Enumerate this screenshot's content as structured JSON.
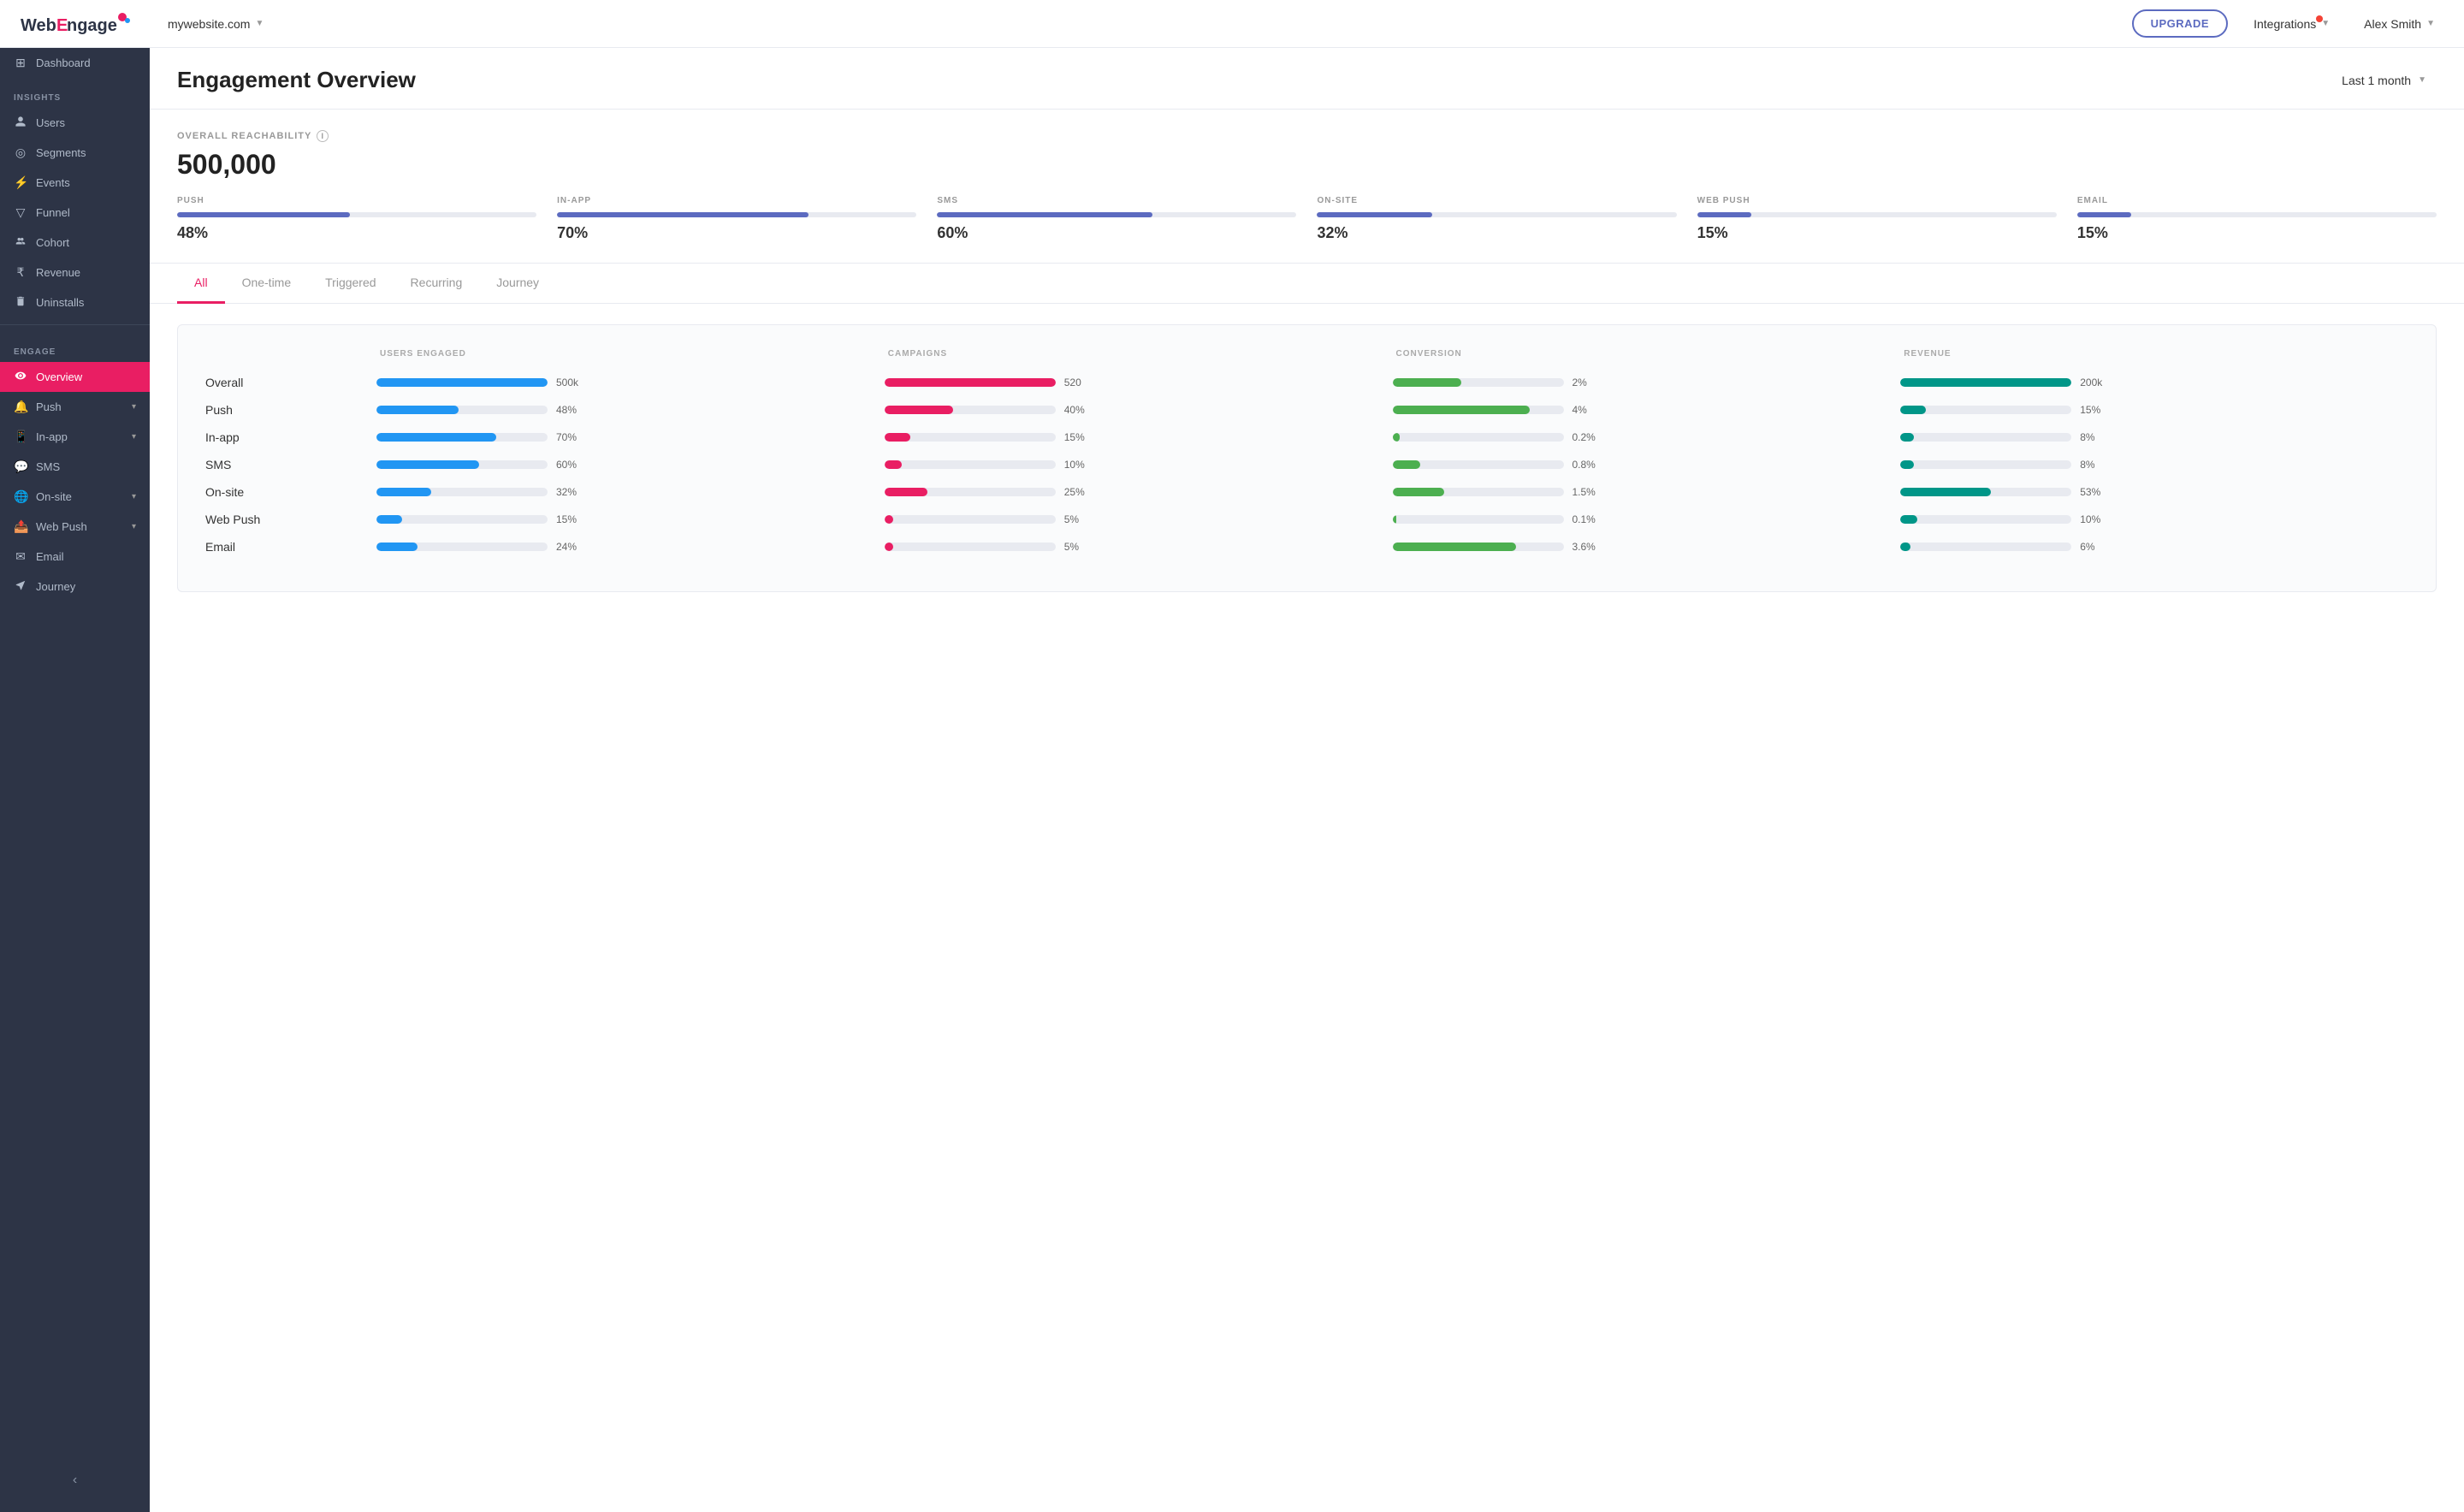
{
  "topnav": {
    "logo_text": "WebEngage",
    "site": "mywebsite.com",
    "upgrade_label": "UPGRADE",
    "integrations_label": "Integrations",
    "user_name": "Alex Smith"
  },
  "sidebar": {
    "insights_label": "INSIGHTS",
    "engage_label": "ENGAGE",
    "items": [
      {
        "id": "dashboard",
        "label": "Dashboard",
        "icon": "⊞"
      },
      {
        "id": "users",
        "label": "Users",
        "icon": "👤"
      },
      {
        "id": "segments",
        "label": "Segments",
        "icon": "◎"
      },
      {
        "id": "events",
        "label": "Events",
        "icon": "⚡"
      },
      {
        "id": "funnel",
        "label": "Funnel",
        "icon": "▽"
      },
      {
        "id": "cohort",
        "label": "Cohort",
        "icon": "👥"
      },
      {
        "id": "revenue",
        "label": "Revenue",
        "icon": "₹"
      },
      {
        "id": "uninstalls",
        "label": "Uninstalls",
        "icon": "🗑"
      },
      {
        "id": "overview",
        "label": "Overview",
        "icon": "👁",
        "active": true
      },
      {
        "id": "push",
        "label": "Push",
        "icon": "🔔"
      },
      {
        "id": "in-app",
        "label": "In-app",
        "icon": "📱"
      },
      {
        "id": "sms",
        "label": "SMS",
        "icon": "💬"
      },
      {
        "id": "on-site",
        "label": "On-site",
        "icon": "🌐"
      },
      {
        "id": "web-push",
        "label": "Web Push",
        "icon": "📤"
      },
      {
        "id": "email",
        "label": "Email",
        "icon": "✉"
      },
      {
        "id": "journey",
        "label": "Journey",
        "icon": "🗺"
      }
    ]
  },
  "page": {
    "title": "Engagement Overview",
    "date_filter": "Last 1 month"
  },
  "reachability": {
    "section_label": "OVERALL REACHABILITY",
    "total": "500,000",
    "channels": [
      {
        "name": "PUSH",
        "pct": "48%",
        "fill_pct": 48,
        "color": "#5c6bc0"
      },
      {
        "name": "IN-APP",
        "pct": "70%",
        "fill_pct": 70,
        "color": "#5c6bc0"
      },
      {
        "name": "SMS",
        "pct": "60%",
        "fill_pct": 60,
        "color": "#5c6bc0"
      },
      {
        "name": "ON-SITE",
        "pct": "32%",
        "fill_pct": 32,
        "color": "#5c6bc0"
      },
      {
        "name": "WEB PUSH",
        "pct": "15%",
        "fill_pct": 15,
        "color": "#5c6bc0"
      },
      {
        "name": "EMAIL",
        "pct": "15%",
        "fill_pct": 15,
        "color": "#5c6bc0"
      }
    ]
  },
  "tabs": [
    {
      "id": "all",
      "label": "All",
      "active": true
    },
    {
      "id": "one-time",
      "label": "One-time"
    },
    {
      "id": "triggered",
      "label": "Triggered"
    },
    {
      "id": "recurring",
      "label": "Recurring"
    },
    {
      "id": "journey",
      "label": "Journey"
    }
  ],
  "chart": {
    "col_labels": [
      "",
      "USERS ENGAGED",
      "CAMPAIGNS",
      "CONVERSION",
      "REVENUE"
    ],
    "rows": [
      {
        "label": "Overall",
        "users_engaged": {
          "value": "500k",
          "pct": 100
        },
        "campaigns": {
          "value": "520",
          "pct": 100
        },
        "conversion": {
          "value": "2%",
          "pct": 2
        },
        "revenue": {
          "value": "200k",
          "pct": 100
        }
      },
      {
        "label": "Push",
        "users_engaged": {
          "value": "48%",
          "pct": 48
        },
        "campaigns": {
          "value": "40%",
          "pct": 40
        },
        "conversion": {
          "value": "4%",
          "pct": 4
        },
        "revenue": {
          "value": "15%",
          "pct": 15
        }
      },
      {
        "label": "In-app",
        "users_engaged": {
          "value": "70%",
          "pct": 70
        },
        "campaigns": {
          "value": "15%",
          "pct": 15
        },
        "conversion": {
          "value": "0.2%",
          "pct": 0.2
        },
        "revenue": {
          "value": "8%",
          "pct": 8
        }
      },
      {
        "label": "SMS",
        "users_engaged": {
          "value": "60%",
          "pct": 60
        },
        "campaigns": {
          "value": "10%",
          "pct": 10
        },
        "conversion": {
          "value": "0.8%",
          "pct": 0.8
        },
        "revenue": {
          "value": "8%",
          "pct": 8
        }
      },
      {
        "label": "On-site",
        "users_engaged": {
          "value": "32%",
          "pct": 32
        },
        "campaigns": {
          "value": "25%",
          "pct": 25
        },
        "conversion": {
          "value": "1.5%",
          "pct": 1.5
        },
        "revenue": {
          "value": "53%",
          "pct": 53
        }
      },
      {
        "label": "Web Push",
        "users_engaged": {
          "value": "15%",
          "pct": 15
        },
        "campaigns": {
          "value": "5%",
          "pct": 5
        },
        "conversion": {
          "value": "0.1%",
          "pct": 0.1
        },
        "revenue": {
          "value": "10%",
          "pct": 10
        }
      },
      {
        "label": "Email",
        "users_engaged": {
          "value": "24%",
          "pct": 24
        },
        "campaigns": {
          "value": "5%",
          "pct": 5
        },
        "conversion": {
          "value": "3.6%",
          "pct": 3.6
        },
        "revenue": {
          "value": "6%",
          "pct": 6
        }
      }
    ]
  }
}
